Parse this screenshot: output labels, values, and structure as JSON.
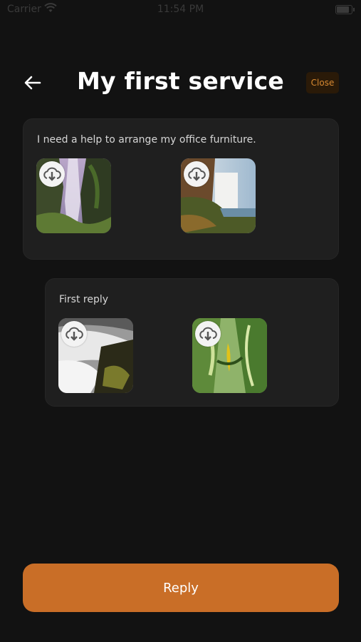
{
  "status_bar": {
    "carrier": "Carrier",
    "time": "11:54 PM",
    "wifi_icon": "wifi-icon",
    "battery_icon": "battery-icon"
  },
  "header": {
    "back_icon": "arrow-left-icon",
    "title": "My first service",
    "close_label": "Close"
  },
  "request": {
    "text": "I need a help to arrange my office furniture.",
    "attachments": [
      {
        "image": "waterfall-mossy-cliff",
        "action_icon": "cloud-download-icon"
      },
      {
        "image": "waterfall-rocky-coast",
        "action_icon": "cloud-download-icon"
      }
    ]
  },
  "reply_entry": {
    "text": "First reply",
    "attachments": [
      {
        "image": "waterfall-long-exposure",
        "action_icon": "cloud-download-icon"
      },
      {
        "image": "green-plant-leaves",
        "action_icon": "cloud-download-icon"
      }
    ]
  },
  "footer": {
    "reply_label": "Reply"
  },
  "colors": {
    "background": "#121212",
    "card": "#1f1f1f",
    "accent": "#c96e27",
    "close_text": "#d98a32",
    "title": "#ffffff"
  }
}
